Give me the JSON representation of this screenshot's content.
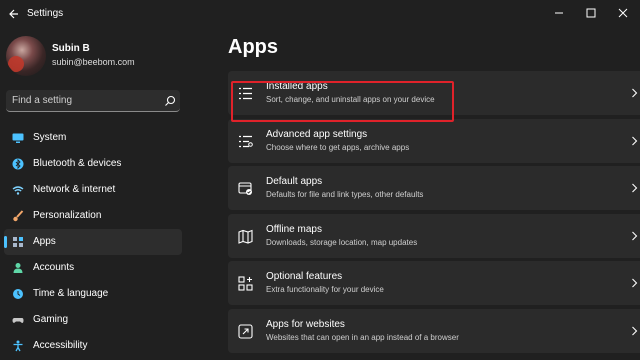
{
  "window": {
    "title": "Settings"
  },
  "profile": {
    "name": "Subin B",
    "email": "subin@beebom.com"
  },
  "search": {
    "placeholder": "Find a setting"
  },
  "sidebar": {
    "items": [
      {
        "label": "System",
        "icon": "monitor-icon",
        "color": "#4cc2ff",
        "active": false
      },
      {
        "label": "Bluetooth & devices",
        "icon": "bluetooth-icon",
        "color": "#4cc2ff",
        "active": false
      },
      {
        "label": "Network & internet",
        "icon": "wifi-icon",
        "color": "#7fd3ff",
        "active": false
      },
      {
        "label": "Personalization",
        "icon": "brush-icon",
        "color": "#f3a76a",
        "active": false
      },
      {
        "label": "Apps",
        "icon": "apps-icon",
        "color": "#a9b8cc",
        "active": true
      },
      {
        "label": "Accounts",
        "icon": "person-icon",
        "color": "#5fd7a7",
        "active": false
      },
      {
        "label": "Time & language",
        "icon": "globe-clock-icon",
        "color": "#4cc2ff",
        "active": false
      },
      {
        "label": "Gaming",
        "icon": "gamepad-icon",
        "color": "#c7c7c7",
        "active": false
      },
      {
        "label": "Accessibility",
        "icon": "accessibility-icon",
        "color": "#4cc2ff",
        "active": false
      }
    ]
  },
  "main": {
    "title": "Apps",
    "cards": [
      {
        "title": "Installed apps",
        "subtitle": "Sort, change, and uninstall apps on your device",
        "icon": "list-icon",
        "highlighted": true
      },
      {
        "title": "Advanced app settings",
        "subtitle": "Choose where to get apps, archive apps",
        "icon": "list-settings-icon",
        "highlighted": false
      },
      {
        "title": "Default apps",
        "subtitle": "Defaults for file and link types, other defaults",
        "icon": "default-apps-icon",
        "highlighted": false
      },
      {
        "title": "Offline maps",
        "subtitle": "Downloads, storage location, map updates",
        "icon": "map-icon",
        "highlighted": false
      },
      {
        "title": "Optional features",
        "subtitle": "Extra functionality for your device",
        "icon": "grid-plus-icon",
        "highlighted": false
      },
      {
        "title": "Apps for websites",
        "subtitle": "Websites that can open in an app instead of a browser",
        "icon": "web-app-icon",
        "highlighted": false
      }
    ]
  },
  "colors": {
    "accent": "#4cc2ff",
    "highlight_border": "#e0222a",
    "background": "#202020",
    "card": "#2b2b2b"
  }
}
